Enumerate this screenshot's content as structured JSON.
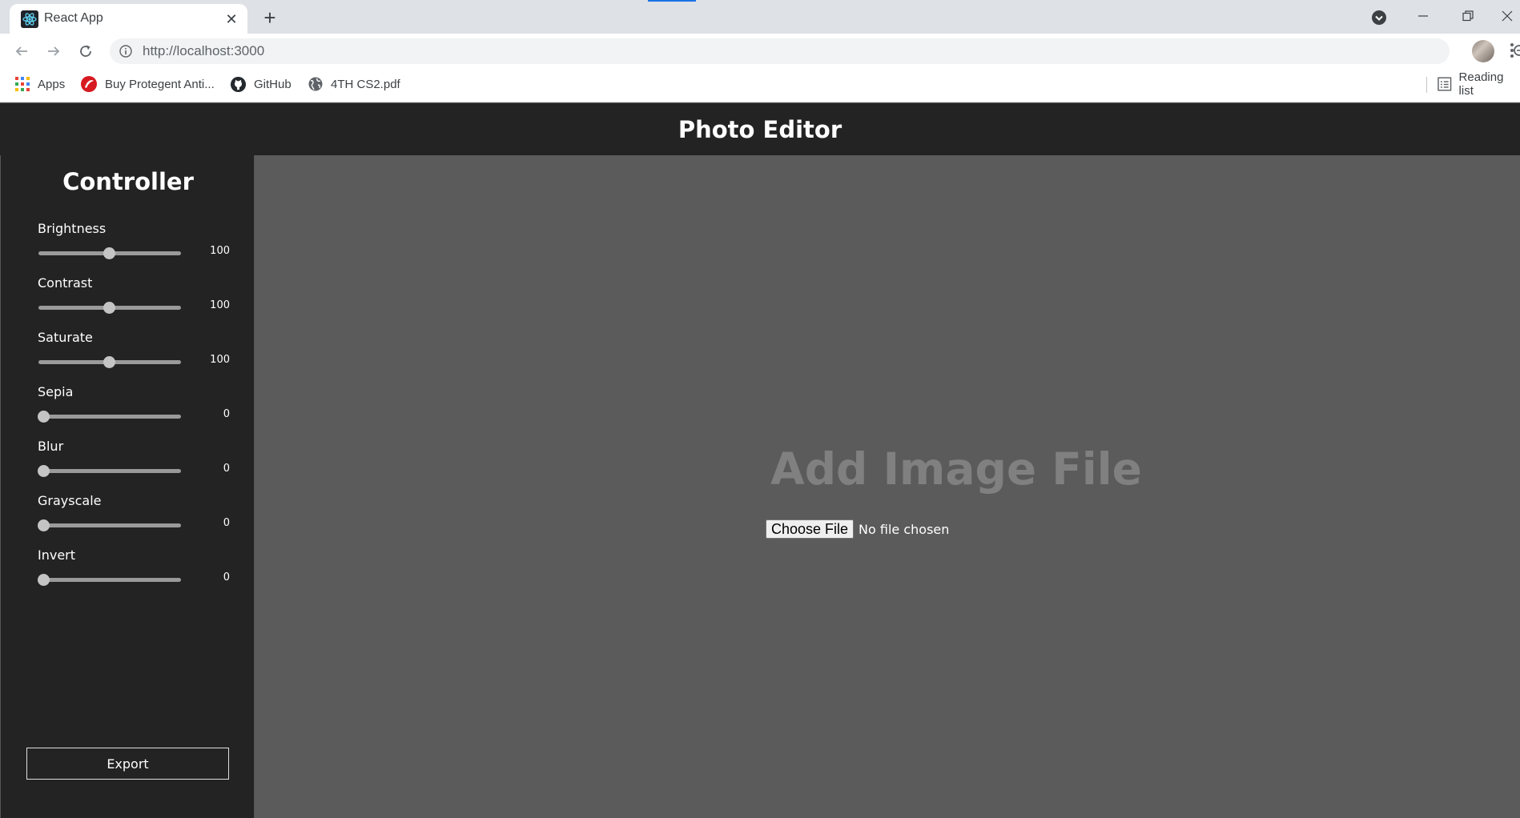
{
  "browser": {
    "tab_title": "React App",
    "url": "http://localhost:3000",
    "bookmarks": [
      {
        "label": "Apps",
        "icon": "apps-grid-icon"
      },
      {
        "label": "Buy Protegent Anti...",
        "icon": "protegent-icon"
      },
      {
        "label": "GitHub",
        "icon": "github-icon"
      },
      {
        "label": "4TH CS2.pdf",
        "icon": "globe-icon"
      }
    ],
    "reading_list": "Reading list"
  },
  "app": {
    "title": "Photo Editor"
  },
  "sidebar": {
    "title": "Controller",
    "controls": [
      {
        "label": "Brightness",
        "value": "100",
        "min": 0,
        "max": 200
      },
      {
        "label": "Contrast",
        "value": "100",
        "min": 0,
        "max": 200
      },
      {
        "label": "Saturate",
        "value": "100",
        "min": 0,
        "max": 200
      },
      {
        "label": "Sepia",
        "value": "0",
        "min": 0,
        "max": 100
      },
      {
        "label": "Blur",
        "value": "0",
        "min": 0,
        "max": 100
      },
      {
        "label": "Grayscale",
        "value": "0",
        "min": 0,
        "max": 100
      },
      {
        "label": "Invert",
        "value": "0",
        "min": 0,
        "max": 100
      }
    ],
    "export_label": "Export"
  },
  "main": {
    "heading": "Add Image File",
    "choose_file_label": "Choose File",
    "file_status": "No file chosen"
  },
  "colors": {
    "header_bg": "#232323",
    "canvas_bg": "#5b5b5b",
    "heading_color": "#808080"
  }
}
